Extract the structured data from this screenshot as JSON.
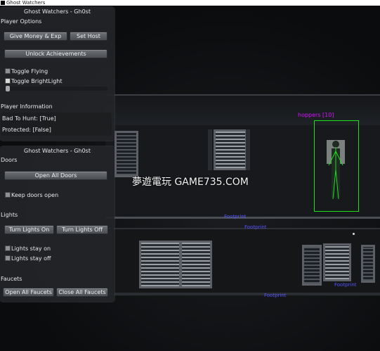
{
  "window": {
    "title": "Ghost Watchers"
  },
  "menu1": {
    "title": "Ghost Watchers - Gh0st",
    "player_options_label": "Player Options",
    "give_money_label": "Give Money & Exp",
    "set_host_label": "Set Host",
    "unlock_achievements_label": "Unlock Achievements",
    "toggle_flying_label": "Toggle Flying",
    "toggle_flying_checked": false,
    "toggle_brightlight_label": "Toggle BrightLight",
    "toggle_brightlight_checked": true,
    "brightlight_slider_value": 0,
    "player_information_label": "Player Information",
    "bad_to_hunt_text": "Bad To Hunt: [True]",
    "protected_text": "Protected: [False]"
  },
  "menu2": {
    "title": "Ghost Watchers - Gh0st",
    "doors_label": "Doors",
    "open_all_doors_label": "Open All Doors",
    "keep_doors_open_label": "Keep doors open",
    "lights_label": "Lights",
    "turn_lights_on_label": "Turn Lights On",
    "turn_lights_off_label": "Turn Lights Off",
    "lights_stay_on_label": "Lights stay on",
    "lights_stay_off_label": "Lights stay off",
    "faucets_label": "Faucets",
    "open_all_faucets_label": "Open All Faucets",
    "close_all_faucets_label": "Close All Faucets"
  },
  "scene": {
    "esp_label": "hoppers [10]",
    "footprint_labels": [
      "Footprint",
      "Footprint",
      "Footprint",
      "Footprint"
    ],
    "watermark": "夢遊電玩 GAME735.COM"
  },
  "colors": {
    "esp_box": "#17e317",
    "esp_text": "#d313ff",
    "footprint": "#5555ff"
  }
}
